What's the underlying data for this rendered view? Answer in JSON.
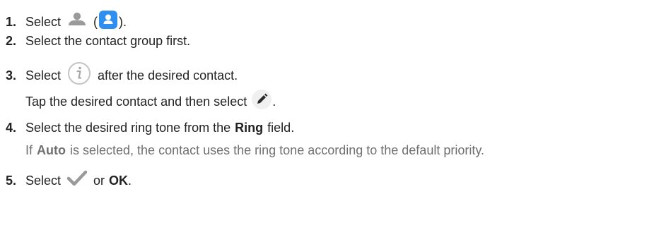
{
  "steps": {
    "s1": {
      "num": "1.",
      "pre": "Select",
      "paren_open": "(",
      "paren_close": ").",
      "icons": [
        "person-icon",
        "contacts-app-icon"
      ]
    },
    "s2": {
      "num": "2.",
      "text": "Select the contact group first."
    },
    "s3": {
      "num": "3.",
      "pre": "Select",
      "post": "after the desired contact.",
      "icon": "info-icon",
      "alt_pre": "Tap the desired contact and then select",
      "alt_post": ".",
      "alt_icon": "edit-pencil-icon"
    },
    "s4": {
      "num": "4.",
      "pre": "Select the desired ring tone from the",
      "bold": "Ring",
      "post": "field.",
      "note_pre": "If",
      "note_bold": "Auto",
      "note_post": "is selected, the contact uses the ring tone according to the default priority."
    },
    "s5": {
      "num": "5.",
      "pre": "Select",
      "mid": "or",
      "bold": "OK",
      "post": ".",
      "icon": "checkmark-icon"
    }
  },
  "colors": {
    "text": "#222222",
    "note": "#707070",
    "icon_gray": "#9a9a9a",
    "contacts_blue": "#2f8ff0"
  }
}
